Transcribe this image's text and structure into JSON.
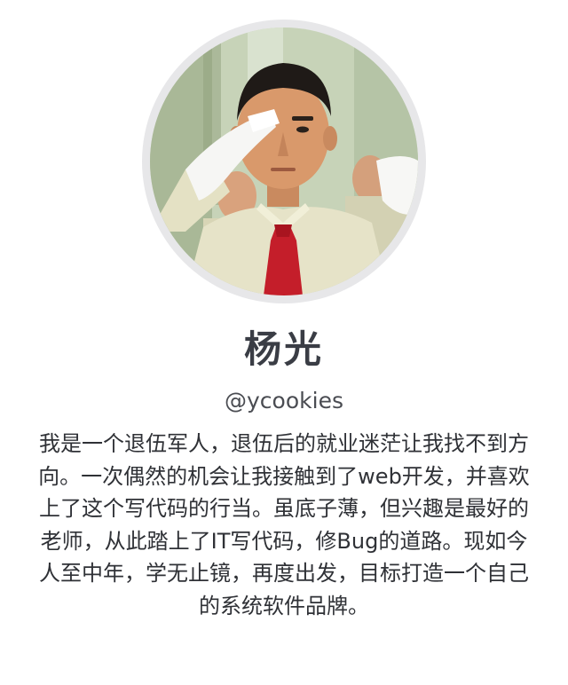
{
  "profile": {
    "display_name": "杨光",
    "username": "@ycookies",
    "bio": "我是一个退伍军人，退伍后的就业迷茫让我找不到方向。一次偶然的机会让我接触到了web开发，并喜欢上了这个写代码的行当。虽底子薄，但兴趣是最好的老师，从此踏上了IT写代码，修Bug的道路。现如今人至中年，学无止镜，再度出发，目标打造一个自己的系统软件品牌。",
    "avatar_icon": "person-saluting-photo"
  },
  "colors": {
    "avatar_ring": "#e7e7e9",
    "name": "#3a3d45",
    "text": "#2f3136"
  }
}
